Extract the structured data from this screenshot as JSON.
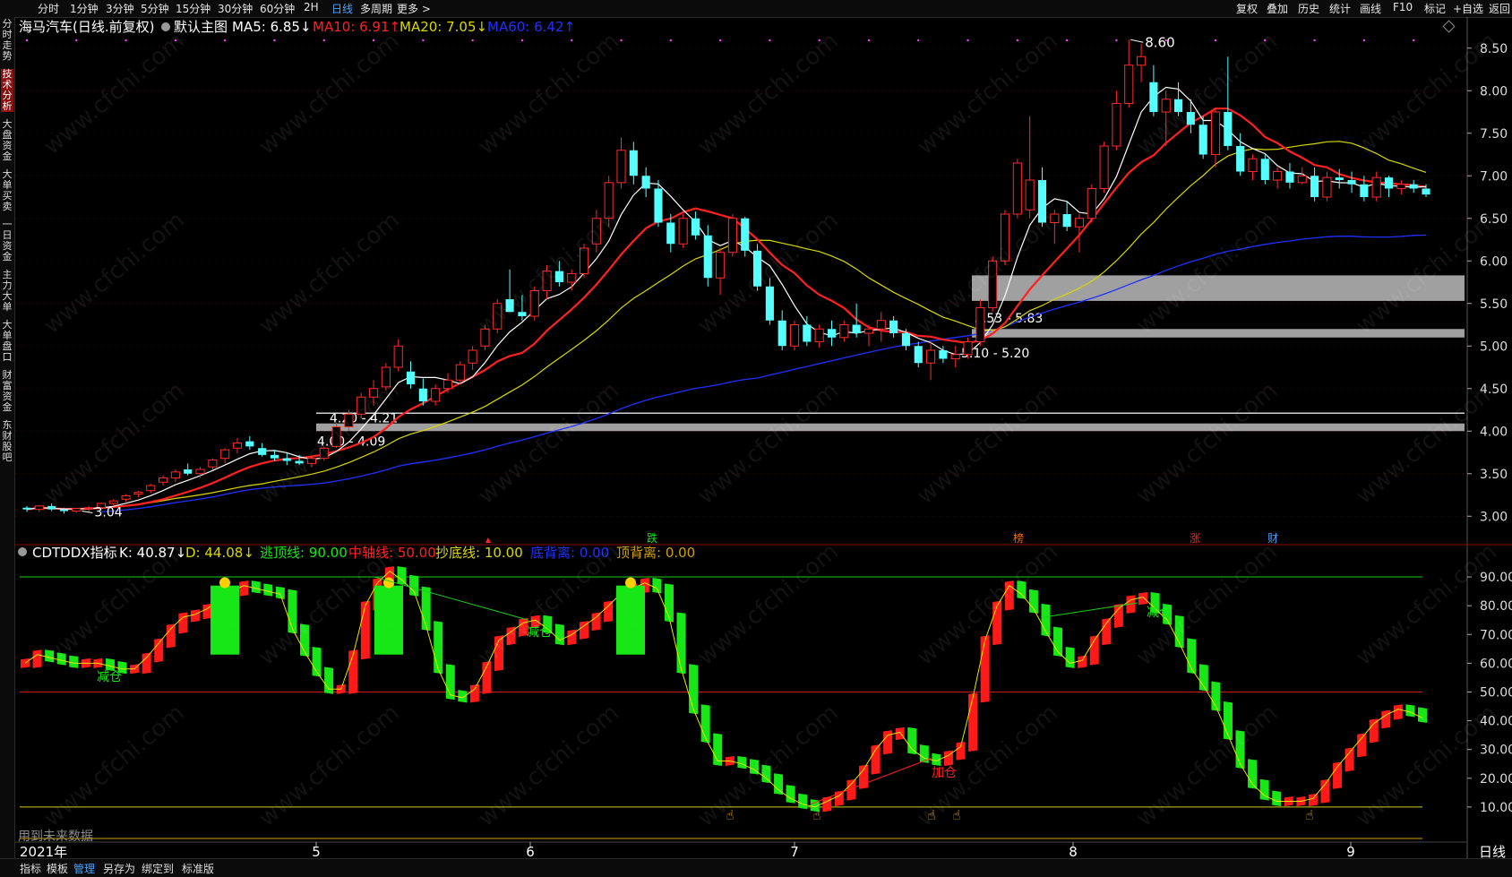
{
  "toolbar": {
    "periods": [
      "分时",
      "1分钟",
      "3分钟",
      "5分钟",
      "15分钟",
      "30分钟",
      "60分钟",
      "2H",
      "日线",
      "多周期",
      "更多 >"
    ],
    "active_period": "日线",
    "right": [
      "复权",
      "叠加",
      "历史",
      "统计",
      "画线",
      "F10",
      "标记",
      "+自选",
      "返回"
    ]
  },
  "sidebar": {
    "items": [
      "分时走势",
      "技术分析",
      "大盘资金",
      "大单买卖",
      "一日资金",
      "主力大单",
      "大单盘口",
      "财富资金",
      "东财股吧"
    ],
    "active": "技术分析"
  },
  "main_header": {
    "name": "海马汽车(日线.前复权)",
    "template": "默认主图",
    "ma5": "MA5: 6.85↓",
    "ma10": "MA10: 6.91↑",
    "ma20": "MA20: 7.05↓",
    "ma60": "MA60: 6.42↑"
  },
  "indicator_header": {
    "name": "CDTDDX指标",
    "k": "K: 40.87↓",
    "d": "D: 44.08↓",
    "escape": "逃顶线: 90.00",
    "mid": "中轴线: 50.00",
    "bottom": "抄底线: 10.00",
    "bottom_div": "底背离: 0.00",
    "top_div": "顶背离: 0.00"
  },
  "footer": {
    "year_label": "2021年",
    "period_label": "日线",
    "tabs": [
      "指标",
      "模板",
      "管理",
      "另存为",
      "绑定到",
      "标准版"
    ],
    "active_tab": "管理",
    "note": "用到未来数据"
  },
  "watermark": "www.cfchi.com",
  "colors": {
    "up": "#ff2a2a",
    "down": "#54ffff",
    "ma5": "#ffffff",
    "ma10": "#ff2020",
    "ma20": "#d8d800",
    "ma60": "#2030ff",
    "k_line": "#e6e600",
    "green": "#17e617"
  },
  "chart_data": [
    {
      "type": "candlestick",
      "title": "海马汽车(日线.前复权)",
      "x_months": [
        "5",
        "6",
        "7",
        "8",
        "9"
      ],
      "ylim": [
        2.75,
        8.75
      ],
      "yticks": [
        3.0,
        3.5,
        4.0,
        4.5,
        5.0,
        5.5,
        6.0,
        6.5,
        7.0,
        7.5,
        8.0,
        8.5
      ],
      "candles": [
        [
          3.1,
          3.12,
          3.05,
          3.08
        ],
        [
          3.08,
          3.13,
          3.05,
          3.12
        ],
        [
          3.12,
          3.15,
          3.06,
          3.08
        ],
        [
          3.08,
          3.1,
          3.03,
          3.06
        ],
        [
          3.06,
          3.1,
          3.04,
          3.09
        ],
        [
          3.09,
          3.12,
          3.05,
          3.1
        ],
        [
          3.1,
          3.16,
          3.08,
          3.15
        ],
        [
          3.15,
          3.2,
          3.12,
          3.18
        ],
        [
          3.2,
          3.26,
          3.17,
          3.24
        ],
        [
          3.26,
          3.3,
          3.22,
          3.28
        ],
        [
          3.3,
          3.38,
          3.27,
          3.36
        ],
        [
          3.4,
          3.48,
          3.36,
          3.45
        ],
        [
          3.45,
          3.55,
          3.4,
          3.52
        ],
        [
          3.55,
          3.62,
          3.48,
          3.5
        ],
        [
          3.5,
          3.58,
          3.45,
          3.55
        ],
        [
          3.58,
          3.68,
          3.55,
          3.66
        ],
        [
          3.68,
          3.8,
          3.62,
          3.78
        ],
        [
          3.8,
          3.92,
          3.74,
          3.86
        ],
        [
          3.88,
          3.94,
          3.78,
          3.82
        ],
        [
          3.8,
          3.86,
          3.7,
          3.72
        ],
        [
          3.72,
          3.78,
          3.65,
          3.68
        ],
        [
          3.68,
          3.74,
          3.6,
          3.65
        ],
        [
          3.65,
          3.72,
          3.6,
          3.62
        ],
        [
          3.62,
          3.7,
          3.58,
          3.68
        ],
        [
          3.68,
          3.82,
          3.65,
          3.8
        ],
        [
          3.82,
          4.1,
          3.8,
          4.05
        ],
        [
          4.05,
          4.25,
          4.0,
          4.2
        ],
        [
          4.2,
          4.45,
          4.15,
          4.4
        ],
        [
          4.4,
          4.6,
          4.3,
          4.5
        ],
        [
          4.52,
          4.8,
          4.48,
          4.75
        ],
        [
          4.75,
          5.08,
          4.7,
          5.0
        ],
        [
          4.7,
          4.82,
          4.5,
          4.55
        ],
        [
          4.5,
          4.62,
          4.3,
          4.35
        ],
        [
          4.35,
          4.55,
          4.3,
          4.5
        ],
        [
          4.5,
          4.68,
          4.45,
          4.6
        ],
        [
          4.6,
          4.82,
          4.55,
          4.78
        ],
        [
          4.8,
          5.0,
          4.72,
          4.95
        ],
        [
          5.0,
          5.25,
          4.95,
          5.2
        ],
        [
          5.2,
          5.55,
          5.15,
          5.5
        ],
        [
          5.55,
          5.9,
          5.48,
          5.4
        ],
        [
          5.4,
          5.6,
          5.3,
          5.35
        ],
        [
          5.35,
          5.7,
          5.3,
          5.65
        ],
        [
          5.65,
          5.95,
          5.55,
          5.88
        ],
        [
          5.88,
          6.0,
          5.7,
          5.75
        ],
        [
          5.75,
          5.9,
          5.65,
          5.85
        ],
        [
          5.85,
          6.2,
          5.8,
          6.15
        ],
        [
          6.2,
          6.6,
          6.1,
          6.5
        ],
        [
          6.5,
          7.0,
          6.4,
          6.92
        ],
        [
          6.92,
          7.45,
          6.85,
          7.3
        ],
        [
          7.3,
          7.4,
          6.9,
          7.0
        ],
        [
          7.0,
          7.1,
          6.75,
          6.85
        ],
        [
          6.85,
          6.95,
          6.4,
          6.45
        ],
        [
          6.45,
          6.55,
          6.1,
          6.2
        ],
        [
          6.2,
          6.55,
          6.15,
          6.5
        ],
        [
          6.5,
          6.58,
          6.25,
          6.3
        ],
        [
          6.3,
          6.42,
          5.7,
          5.8
        ],
        [
          5.8,
          6.15,
          5.6,
          6.1
        ],
        [
          6.1,
          6.55,
          6.05,
          6.5
        ],
        [
          6.5,
          6.52,
          6.05,
          6.12
        ],
        [
          6.12,
          6.2,
          5.65,
          5.7
        ],
        [
          5.7,
          5.8,
          5.25,
          5.3
        ],
        [
          5.3,
          5.42,
          4.95,
          5.0
        ],
        [
          5.0,
          5.3,
          4.95,
          5.25
        ],
        [
          5.25,
          5.35,
          5.0,
          5.05
        ],
        [
          5.05,
          5.25,
          4.98,
          5.2
        ],
        [
          5.2,
          5.3,
          5.0,
          5.1
        ],
        [
          5.1,
          5.3,
          5.05,
          5.25
        ],
        [
          5.25,
          5.5,
          5.1,
          5.15
        ],
        [
          5.15,
          5.25,
          5.0,
          5.2
        ],
        [
          5.2,
          5.4,
          5.05,
          5.3
        ],
        [
          5.3,
          5.35,
          5.1,
          5.15
        ],
        [
          5.15,
          5.2,
          4.95,
          5.0
        ],
        [
          5.0,
          5.05,
          4.75,
          4.8
        ],
        [
          4.8,
          5.05,
          4.6,
          4.95
        ],
        [
          4.95,
          5.0,
          4.8,
          4.85
        ],
        [
          4.85,
          5.0,
          4.75,
          4.9
        ],
        [
          4.9,
          5.1,
          4.85,
          5.05
        ],
        [
          5.05,
          5.55,
          5.0,
          5.45
        ],
        [
          5.45,
          6.05,
          5.4,
          6.0
        ],
        [
          6.0,
          6.6,
          5.95,
          6.55
        ],
        [
          6.55,
          7.2,
          6.5,
          7.15
        ],
        [
          6.6,
          7.7,
          6.5,
          6.95
        ],
        [
          6.95,
          7.1,
          6.4,
          6.45
        ],
        [
          6.45,
          6.6,
          6.2,
          6.55
        ],
        [
          6.55,
          6.7,
          6.35,
          6.4
        ],
        [
          6.4,
          6.55,
          6.1,
          6.5
        ],
        [
          6.5,
          6.9,
          6.45,
          6.85
        ],
        [
          6.85,
          7.4,
          6.8,
          7.35
        ],
        [
          7.35,
          8.0,
          7.3,
          7.85
        ],
        [
          7.85,
          8.6,
          7.8,
          8.3
        ],
        [
          8.3,
          8.55,
          8.1,
          8.4
        ],
        [
          8.1,
          8.3,
          7.7,
          7.75
        ],
        [
          7.75,
          8.0,
          7.35,
          7.9
        ],
        [
          7.9,
          8.1,
          7.7,
          7.75
        ],
        [
          7.75,
          7.9,
          7.5,
          7.6
        ],
        [
          7.6,
          7.7,
          7.2,
          7.25
        ],
        [
          7.25,
          7.8,
          7.1,
          7.75
        ],
        [
          7.75,
          8.4,
          7.3,
          7.35
        ],
        [
          7.35,
          7.5,
          7.0,
          7.05
        ],
        [
          7.05,
          7.25,
          6.95,
          7.2
        ],
        [
          7.2,
          7.25,
          6.9,
          6.95
        ],
        [
          6.95,
          7.1,
          6.85,
          7.05
        ],
        [
          7.05,
          7.15,
          6.85,
          6.92
        ],
        [
          6.92,
          7.1,
          6.9,
          7.0
        ],
        [
          7.0,
          7.1,
          6.7,
          6.75
        ],
        [
          6.75,
          7.05,
          6.7,
          6.98
        ],
        [
          6.98,
          7.08,
          6.85,
          6.95
        ],
        [
          6.95,
          7.05,
          6.8,
          6.9
        ],
        [
          6.9,
          7.0,
          6.7,
          6.75
        ],
        [
          6.75,
          7.05,
          6.7,
          6.98
        ],
        [
          6.98,
          7.0,
          6.75,
          6.85
        ],
        [
          6.85,
          6.95,
          6.78,
          6.9
        ],
        [
          6.9,
          6.95,
          6.8,
          6.85
        ],
        [
          6.85,
          6.9,
          6.75,
          6.78
        ]
      ],
      "annotations": {
        "high_label": "8.60",
        "low_label": "3.04",
        "zone1_label": "5.53 - 5.83",
        "zone2_label": "5.10 - 5.20",
        "zone3_label": "4.20 - 4.21",
        "zone4_label": "4.00 - 4.09",
        "zones": [
          [
            5.53,
            5.83
          ],
          [
            5.1,
            5.2
          ],
          [
            4.2,
            4.21
          ],
          [
            4.0,
            4.09
          ]
        ],
        "event_tags": [
          "跌",
          "榜",
          "涨",
          "财"
        ]
      }
    },
    {
      "type": "line",
      "title": "CDTDDX指标",
      "ylim": [
        0,
        95
      ],
      "yticks": [
        10,
        20,
        30,
        40,
        50,
        60,
        70,
        80,
        90
      ],
      "hlines": [
        90,
        50,
        10
      ],
      "k": [
        60,
        63,
        62,
        61,
        60,
        60,
        60,
        59,
        58,
        58,
        62,
        67,
        72,
        76,
        77,
        79,
        82,
        85,
        87,
        86,
        85,
        84,
        72,
        64,
        57,
        51,
        51,
        63,
        80,
        88,
        92,
        89,
        85,
        73,
        58,
        49,
        48,
        51,
        59,
        68,
        71,
        74,
        75,
        72,
        68,
        70,
        73,
        76,
        80,
        84,
        86,
        88,
        86,
        76,
        58,
        44,
        34,
        26,
        26,
        25,
        23,
        20,
        16,
        13,
        11,
        10,
        12,
        14,
        18,
        23,
        30,
        35,
        36,
        30,
        27,
        26,
        28,
        31,
        48,
        68,
        80,
        87,
        84,
        79,
        71,
        64,
        60,
        61,
        68,
        74,
        79,
        82,
        83,
        79,
        75,
        67,
        58,
        52,
        45,
        35,
        25,
        18,
        14,
        12,
        12,
        12,
        13,
        18,
        24,
        29,
        34,
        39,
        42,
        44,
        43,
        41
      ],
      "labels": [
        "减仓",
        "卖",
        "卖",
        "减仓",
        "卖",
        "加仓",
        "减仓"
      ]
    }
  ]
}
